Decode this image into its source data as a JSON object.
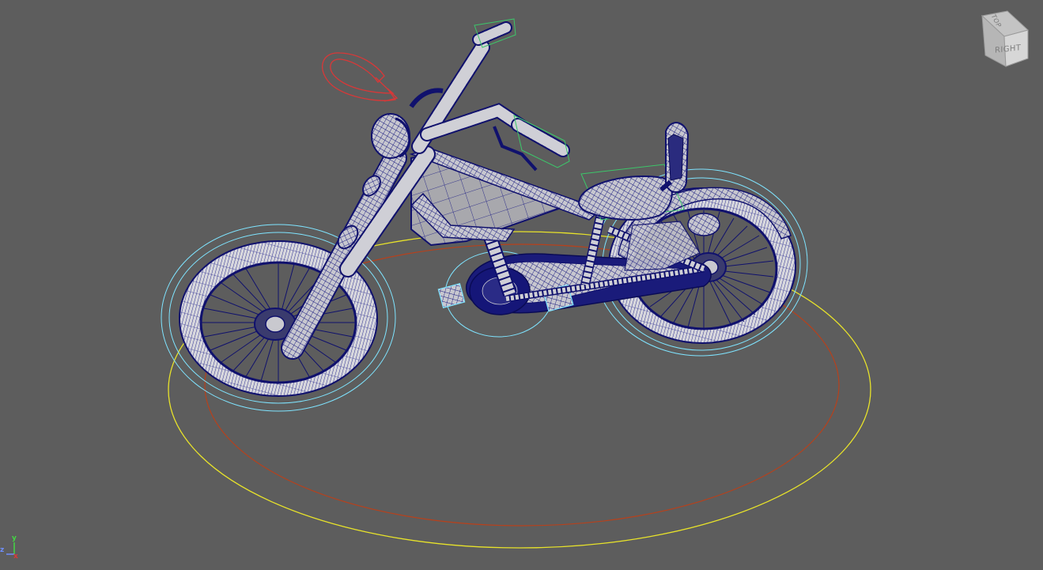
{
  "viewport": {
    "background": "#5d5d5d",
    "wire_color": "#0e0f7a",
    "shaded_color": "#c9c9cf",
    "selection_color": "#7fe4ff",
    "curve_yellow": "#e8e32a",
    "curve_red": "#b7411c",
    "ik_handle_color": "#d83838",
    "locator_green": "#3cc76a"
  },
  "view_cube": {
    "top_label": "TOP",
    "right_label": "RIGHT",
    "icon": "view-cube-icon"
  },
  "axis_gizmo": {
    "y_label": "y",
    "z_label": "z",
    "x_label": "x",
    "icon": "axis-gizmo-icon"
  }
}
